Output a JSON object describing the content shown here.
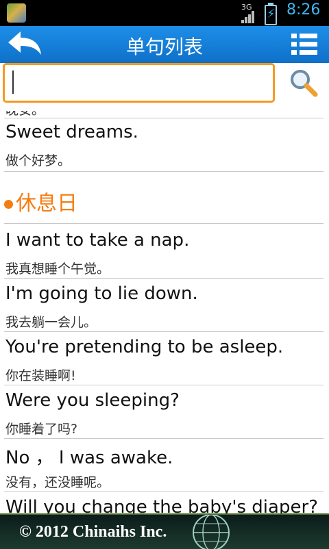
{
  "status": {
    "network": "3G",
    "time": "8:26"
  },
  "header": {
    "title": "单句列表"
  },
  "search": {
    "placeholder": ""
  },
  "list": {
    "partial_top_zh": "晚安。",
    "item_0": {
      "en": "Sweet dreams.",
      "zh": "做个好梦。"
    },
    "section": {
      "title": "休息日"
    },
    "item_1": {
      "en": "I want to take a nap.",
      "zh": "我真想睡个午觉。"
    },
    "item_2": {
      "en": "I'm going to lie down.",
      "zh": "我去躺一会儿。"
    },
    "item_3": {
      "en": "You're pretending to be asleep.",
      "zh": "你在装睡啊!"
    },
    "item_4": {
      "en": "Were you sleeping?",
      "zh": "你睡着了吗?"
    },
    "item_5": {
      "en": "No ， I was awake.",
      "zh": "没有，还没睡呢。"
    },
    "item_6": {
      "en": "Will you change the baby's diaper?"
    }
  },
  "footer": {
    "copyright": "© 2012 Chinaihs Inc."
  }
}
